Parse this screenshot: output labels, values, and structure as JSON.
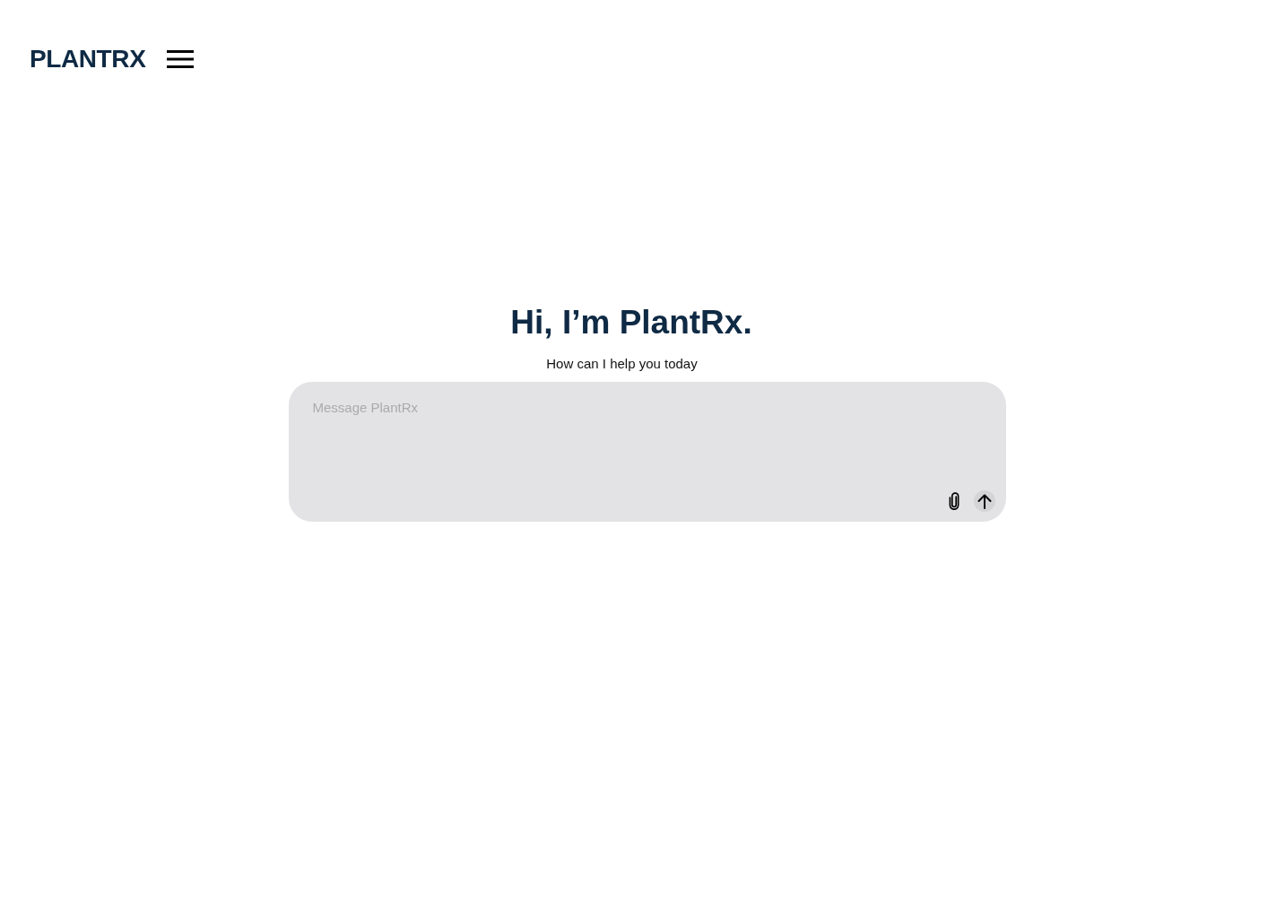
{
  "header": {
    "logo": "PLANTRX"
  },
  "greeting": {
    "title": "Hi, I’m PlantRx.",
    "subtitle": "How can I help you today"
  },
  "composer": {
    "placeholder": "Message PlantRx"
  }
}
